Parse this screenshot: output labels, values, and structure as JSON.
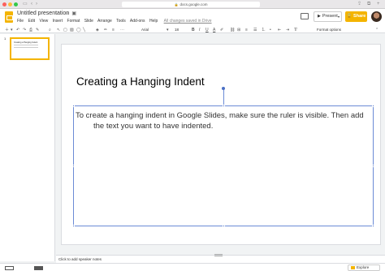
{
  "browser": {
    "url": "docs.google.com"
  },
  "header": {
    "doc_title": "Untitled presentation",
    "menu": [
      "File",
      "Edit",
      "View",
      "Insert",
      "Format",
      "Slide",
      "Arrange",
      "Tools",
      "Add-ons",
      "Help"
    ],
    "saved_status": "All changes saved in Drive",
    "present_label": "Present",
    "share_label": "Share"
  },
  "toolbar": {
    "font": "Arial",
    "font_size": "18",
    "format_options_label": "Format options"
  },
  "filmstrip": {
    "slide_number": "1",
    "thumb_title": "Creating a Hanging Indent"
  },
  "slide": {
    "title": "Creating a Hanging Indent",
    "body": "To create a hanging indent in Google Slides, make sure the ruler is visible. Then add the text you want to have indented."
  },
  "notes": {
    "placeholder": "Click to add speaker notes"
  },
  "bottom": {
    "explore_label": "Explore"
  },
  "colors": {
    "accent": "#f4b400",
    "selection": "#4a6fc4"
  }
}
